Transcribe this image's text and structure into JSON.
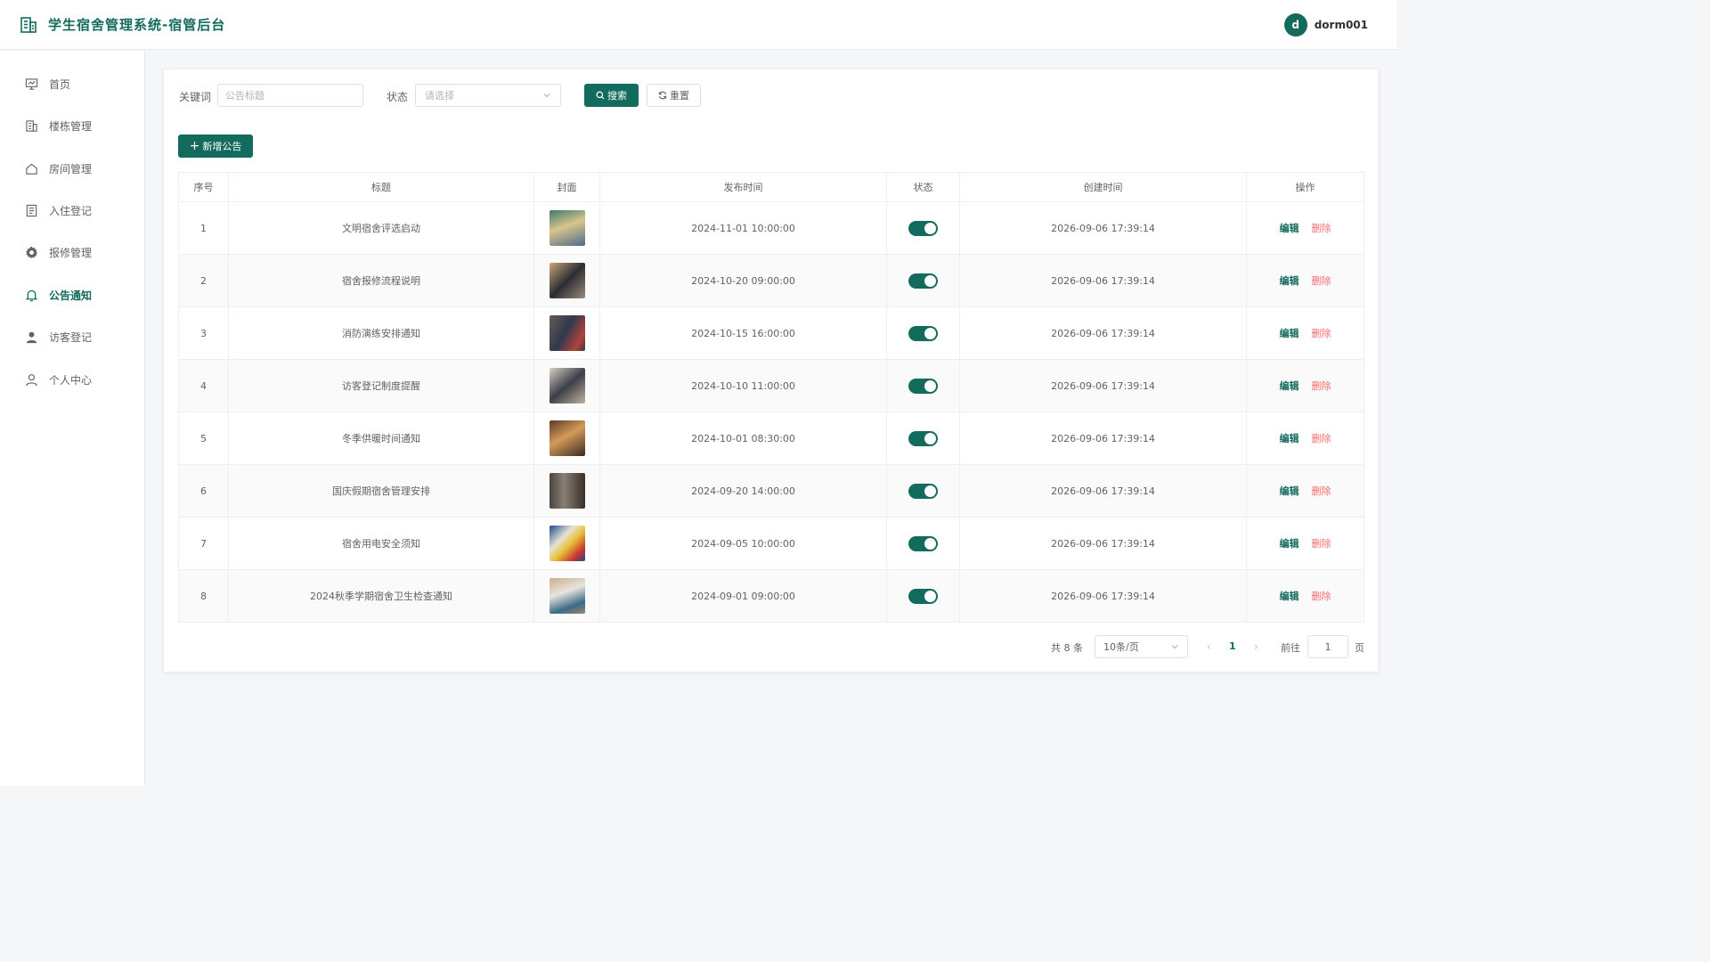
{
  "header": {
    "title": "学生宿舍管理系统-宿管后台",
    "avatar_letter": "d",
    "username": "dorm001"
  },
  "sidebar": {
    "items": [
      {
        "label": "首页",
        "icon": "dashboard-icon"
      },
      {
        "label": "楼栋管理",
        "icon": "building-icon"
      },
      {
        "label": "房间管理",
        "icon": "house-icon"
      },
      {
        "label": "入住登记",
        "icon": "document-icon"
      },
      {
        "label": "报修管理",
        "icon": "gear-icon"
      },
      {
        "label": "公告通知",
        "icon": "bell-icon",
        "active": true
      },
      {
        "label": "访客登记",
        "icon": "user-filled-icon"
      },
      {
        "label": "个人中心",
        "icon": "user-outline-icon"
      }
    ]
  },
  "filters": {
    "keyword_label": "关键词",
    "keyword_placeholder": "公告标题",
    "status_label": "状态",
    "status_placeholder": "请选择",
    "search_label": "搜索",
    "reset_label": "重置",
    "add_label": "新增公告"
  },
  "table": {
    "columns": [
      "序号",
      "标题",
      "封面",
      "发布时间",
      "状态",
      "创建时间",
      "操作"
    ],
    "edit_label": "编辑",
    "delete_label": "删除",
    "rows": [
      {
        "index": "1",
        "title": "文明宿舍评选启动",
        "publish_time": "2024-11-01 10:00:00",
        "enabled": true,
        "created": "2026-09-06 17:39:14"
      },
      {
        "index": "2",
        "title": "宿舍报修流程说明",
        "publish_time": "2024-10-20 09:00:00",
        "enabled": true,
        "created": "2026-09-06 17:39:14"
      },
      {
        "index": "3",
        "title": "消防演练安排通知",
        "publish_time": "2024-10-15 16:00:00",
        "enabled": true,
        "created": "2026-09-06 17:39:14"
      },
      {
        "index": "4",
        "title": "访客登记制度提醒",
        "publish_time": "2024-10-10 11:00:00",
        "enabled": true,
        "created": "2026-09-06 17:39:14"
      },
      {
        "index": "5",
        "title": "冬季供暖时间通知",
        "publish_time": "2024-10-01 08:30:00",
        "enabled": true,
        "created": "2026-09-06 17:39:14"
      },
      {
        "index": "6",
        "title": "国庆假期宿舍管理安排",
        "publish_time": "2024-09-20 14:00:00",
        "enabled": true,
        "created": "2026-09-06 17:39:14"
      },
      {
        "index": "7",
        "title": "宿舍用电安全须知",
        "publish_time": "2024-09-05 10:00:00",
        "enabled": true,
        "created": "2026-09-06 17:39:14"
      },
      {
        "index": "8",
        "title": "2024秋季学期宿舍卫生检查通知",
        "publish_time": "2024-09-01 09:00:00",
        "enabled": true,
        "created": "2026-09-06 17:39:14"
      }
    ]
  },
  "pagination": {
    "total_text": "共 8 条",
    "page_size": "10条/页",
    "current_page": "1",
    "goto_label": "前往",
    "goto_value": "1",
    "page_suffix": "页"
  },
  "colors": {
    "primary": "#136b5e",
    "danger": "#f56c6c"
  }
}
